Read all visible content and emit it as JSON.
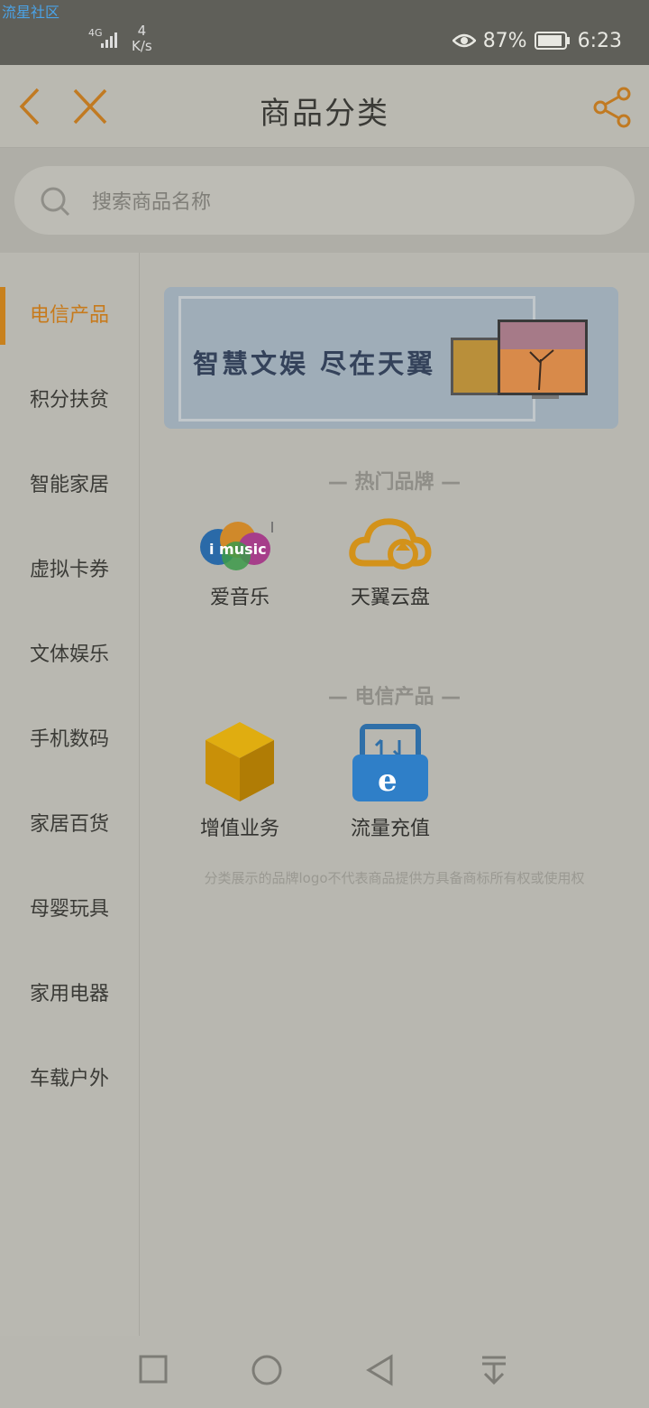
{
  "status": {
    "watermark": "流星社区",
    "network": "4G",
    "speed_value": "4",
    "speed_unit": "K/s",
    "battery": "87%",
    "time": "6:23"
  },
  "header": {
    "title": "商品分类",
    "back": "chevron-left-icon",
    "close": "close-icon",
    "share": "share-icon"
  },
  "search": {
    "placeholder": "搜索商品名称"
  },
  "sidebar": {
    "items": [
      {
        "label": "电信产品",
        "active": true
      },
      {
        "label": "积分扶贫"
      },
      {
        "label": "智能家居"
      },
      {
        "label": "虚拟卡券"
      },
      {
        "label": "文体娱乐"
      },
      {
        "label": "手机数码"
      },
      {
        "label": "家居百货"
      },
      {
        "label": "母婴玩具"
      },
      {
        "label": "家用电器"
      },
      {
        "label": "车载户外"
      }
    ]
  },
  "banner": {
    "text": "智慧文娱 尽在天翼"
  },
  "sections": {
    "hot": {
      "title": "— 热门品牌 —",
      "items": [
        {
          "label": "爱音乐",
          "icon": "imusic-icon"
        },
        {
          "label": "天翼云盘",
          "icon": "cloud-icon"
        }
      ]
    },
    "telecom": {
      "title": "— 电信产品 —",
      "items": [
        {
          "label": "增值业务",
          "icon": "box-icon"
        },
        {
          "label": "流量充值",
          "icon": "data-recharge-icon"
        }
      ]
    }
  },
  "imusic_logo": "i music",
  "disclaimer": "分类展示的品牌logo不代表商品提供方具备商标所有权或使用权",
  "colors": {
    "accent": "#c77a1c",
    "overlay": "#b8b7b0"
  }
}
